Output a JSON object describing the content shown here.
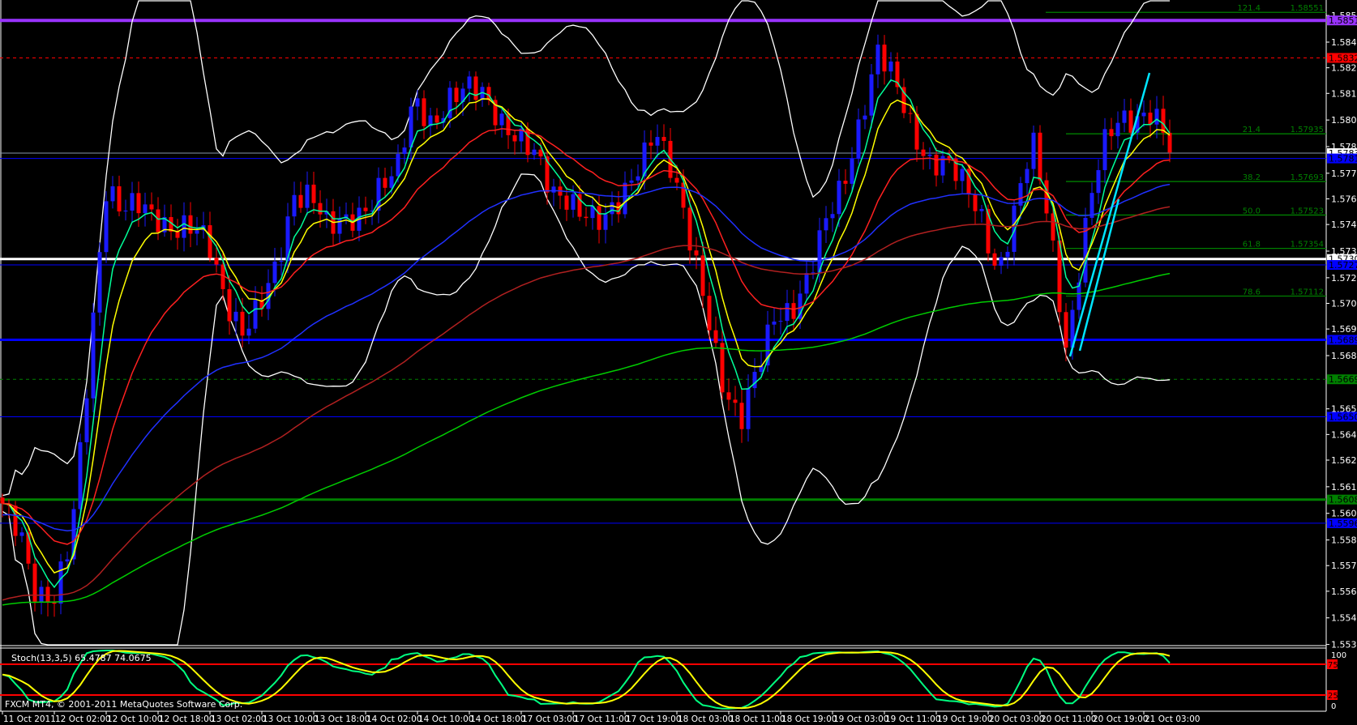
{
  "window": {
    "symbol_info": "FXCM MT4, © 2001-2011 MetaQuotes Software Corp."
  },
  "colors": {
    "background": "#000000",
    "bull": "#0000ff",
    "bear": "#ff0000",
    "axis": "#ffffff"
  },
  "chart_data": {
    "type": "candlestick",
    "timeframe_hours": 1,
    "price_axis": {
      "range": [
        1.552,
        1.5862
      ],
      "ticks": [
        "1.58535",
        "1.58400",
        "1.58270",
        "1.58140",
        "1.58005",
        "1.57870",
        "1.57735",
        "1.57605",
        "1.57475",
        "1.57340",
        "1.57205",
        "1.57075",
        "1.56945",
        "1.56810",
        "1.56540",
        "1.56410",
        "1.56280",
        "1.56145",
        "1.56010",
        "1.55875",
        "1.55745",
        "1.55615",
        "1.55480",
        "1.55345"
      ]
    },
    "time_axis": {
      "ticks": [
        "11 Oct 2011",
        "12 Oct 02:00",
        "12 Oct 10:00",
        "12 Oct 18:00",
        "13 Oct 02:00",
        "13 Oct 10:00",
        "13 Oct 18:00",
        "14 Oct 02:00",
        "14 Oct 10:00",
        "14 Oct 18:00",
        "17 Oct 03:00",
        "17 Oct 11:00",
        "17 Oct 19:00",
        "18 Oct 03:00",
        "18 Oct 11:00",
        "18 Oct 19:00",
        "19 Oct 03:00",
        "19 Oct 11:00",
        "19 Oct 19:00",
        "20 Oct 03:00",
        "20 Oct 11:00",
        "20 Oct 19:00",
        "21 Oct 03:00"
      ]
    },
    "bar_count": 181,
    "close_path": [
      1.5606,
      1.5597,
      1.5558,
      1.5553,
      1.5589,
      1.5677,
      1.5765,
      1.5751,
      1.5758,
      1.5754,
      1.5745,
      1.5743,
      1.5738,
      1.5712,
      1.5694,
      1.5703,
      1.5725,
      1.5765,
      1.5765,
      1.5743,
      1.5747,
      1.5756,
      1.5769,
      1.5773,
      1.5809,
      1.58,
      1.5813,
      1.5815,
      1.5811,
      1.5802,
      1.5795,
      1.5782,
      1.576,
      1.5762,
      1.5756,
      1.5747,
      1.5756,
      1.5778,
      1.58,
      1.5773,
      1.5738,
      1.5707,
      1.5668,
      1.5646,
      1.5672,
      1.5703,
      1.5707,
      1.5721,
      1.5747,
      1.5769,
      1.5804,
      1.5835,
      1.5817,
      1.5795,
      1.5782,
      1.578,
      1.5765,
      1.5751,
      1.5725,
      1.5756,
      1.5787,
      1.5747,
      1.5685,
      1.5743,
      1.5782,
      1.58,
      1.5804,
      1.5806,
      1.5784
    ],
    "moving_averages": [
      {
        "name": "EMA 5",
        "period": 5,
        "color": "#00ff99"
      },
      {
        "name": "EMA 8",
        "period": 8,
        "color": "#ffff00"
      },
      {
        "name": "EMA 21",
        "period": 21,
        "color": "#ff2020"
      },
      {
        "name": "EMA 55",
        "period": 55,
        "color": "#2030ff",
        "seed": 1.56
      },
      {
        "name": "EMA 100",
        "period": 100,
        "color": "#b02020",
        "seed": 1.5556
      },
      {
        "name": "EMA 200",
        "period": 200,
        "color": "#00cc00",
        "seed": 1.5554
      }
    ],
    "bollinger": {
      "period": 20,
      "deviation": 2.5,
      "color": "#ffffff"
    },
    "horizontal_lines": [
      {
        "price": 1.5851,
        "label": "1.58510",
        "color": "#9933ff",
        "width": 4,
        "dash": false
      },
      {
        "price": 1.5832,
        "label": "1.58320",
        "color": "#ff0000",
        "width": 1,
        "dash": true
      },
      {
        "price": 1.57837,
        "label": "1.57837",
        "color": "#8899aa",
        "width": 1,
        "dash": false,
        "label_bg": "#ffffff"
      },
      {
        "price": 1.5781,
        "label": "1.57810",
        "color": "#0000ff",
        "width": 1,
        "dash": false
      },
      {
        "price": 1.573,
        "label": "1.57300",
        "color": "#ffffff",
        "width": 3,
        "dash": false
      },
      {
        "price": 1.5727,
        "label": "1.57270",
        "color": "#0000ff",
        "width": 1,
        "dash": false
      },
      {
        "price": 1.5689,
        "label": "1.56890",
        "color": "#0000ff",
        "width": 3,
        "dash": false
      },
      {
        "price": 1.5669,
        "label": "1.56690",
        "color": "#008000",
        "width": 1,
        "dash": true
      },
      {
        "price": 1.565,
        "label": "1.56500",
        "color": "#0000ff",
        "width": 1,
        "dash": false
      },
      {
        "price": 1.5608,
        "label": "1.56080",
        "color": "#008000",
        "width": 3,
        "dash": false
      },
      {
        "price": 1.5596,
        "label": "1.55960",
        "color": "#0000ff",
        "width": 1,
        "dash": false
      }
    ],
    "fibonacci": [
      {
        "level": "121.4",
        "price": "1.58551"
      },
      {
        "level": "21.4",
        "price": "1.57935"
      },
      {
        "level": "38.2",
        "price": "1.57693"
      },
      {
        "level": "50.0",
        "price": "1.57523"
      },
      {
        "level": "61.8",
        "price": "1.57354"
      },
      {
        "level": "78.6",
        "price": "1.57112"
      }
    ],
    "trendlines": [
      {
        "from": [
          "20 Oct 14:00",
          1.5678
        ],
        "to": [
          "21 Oct 02:00",
          1.5823
        ],
        "color": "#00e5ff"
      },
      {
        "from": [
          "20 Oct 16:00",
          1.5681
        ],
        "to": [
          "20 Oct 22:00",
          1.5758
        ],
        "color": "#00e5ff"
      }
    ],
    "stochastic": {
      "label": "Stoch(13,3,5) 65.4787 74.0675",
      "k": 65.4787,
      "d": 74.0675,
      "levels": [
        "75",
        "25"
      ],
      "scale": [
        "100",
        "0"
      ],
      "k_color": "#00ff80",
      "d_color": "#ffff00"
    }
  }
}
